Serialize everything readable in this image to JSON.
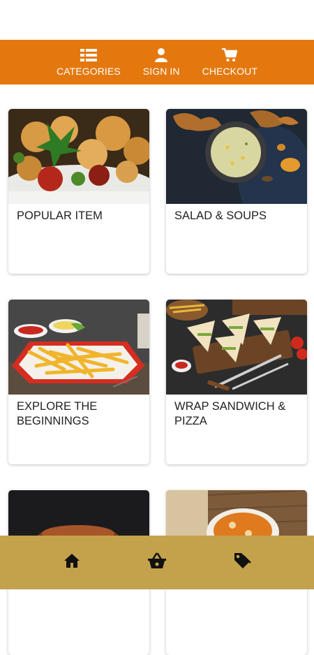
{
  "topnav": {
    "items": [
      {
        "label": "CATEGORIES",
        "icon": "list-icon"
      },
      {
        "label": "SIGN IN",
        "icon": "user-icon"
      },
      {
        "label": "CHECKOUT",
        "icon": "cart-icon"
      }
    ]
  },
  "categories": [
    {
      "title": "POPULAR ITEM"
    },
    {
      "title": "SALAD & SOUPS"
    },
    {
      "title": "EXPLORE THE BEGINNINGS"
    },
    {
      "title": "WRAP SANDWICH & PIZZA"
    },
    {
      "title": ""
    },
    {
      "title": ""
    }
  ],
  "bottomnav": {
    "items": [
      {
        "icon": "home-icon"
      },
      {
        "icon": "basket-icon"
      },
      {
        "icon": "tag-icon"
      }
    ]
  },
  "colors": {
    "topbar": "#e4780e",
    "bottombar": "#c4a24c"
  }
}
